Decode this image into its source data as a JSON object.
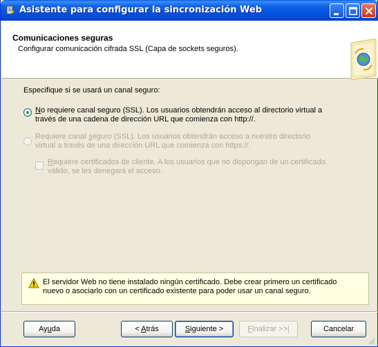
{
  "window": {
    "title": "Asistente para configurar la sincronización Web"
  },
  "header": {
    "title": "Comunicaciones seguras",
    "subtitle": "Configurar comunicación cifrada SSL (Capa de sockets seguros)."
  },
  "prompt": "Especifique si se usará un canal seguro:",
  "options": [
    {
      "line1_pre": "",
      "line1_hotkey": "N",
      "line1_post": "o requiere canal seguro (SSL). Los usuarios obtendrán acceso al directorio virtual a",
      "line2": "través de una cadena de dirección URL que comienza con http://.",
      "selected": true,
      "enabled": true
    },
    {
      "line1_pre": "Requiere canal ",
      "line1_hotkey": "s",
      "line1_post": "eguro (SSL). Los usuarios obtendrán acceso a nuestro directorio",
      "line2": "virtual a través de una dirección URL que comienza con https://.",
      "selected": false,
      "enabled": false
    }
  ],
  "client_cert": {
    "hotkey": "R",
    "line1_post": "equiere certificados de cliente. A los usuarios que no dispongan de un certificado",
    "line2": "válido, se les denegará el acceso.",
    "checked": false,
    "enabled": false
  },
  "warning": {
    "icon": "warning-icon",
    "line1": "El servidor Web no tiene instalado ningún certificado. Debe crear primero un certificado",
    "line2": "nuevo o asociarlo con un certificado existente para poder usar un canal seguro."
  },
  "buttons": {
    "help_pre": "Ay",
    "help_hotkey": "u",
    "help_post": "da",
    "back_pre": "< ",
    "back_hotkey": "A",
    "back_post": "trás",
    "next_hotkey": "S",
    "next_post": "iguiente >",
    "finish_hotkey": "F",
    "finish_post": "inalizar >>|",
    "cancel": "Cancelar"
  },
  "colors": {
    "titlebar": "#0654e0",
    "dialog_bg": "#ece9d8",
    "warning_bg": "#ffffe1",
    "disabled_text": "#aca899"
  }
}
